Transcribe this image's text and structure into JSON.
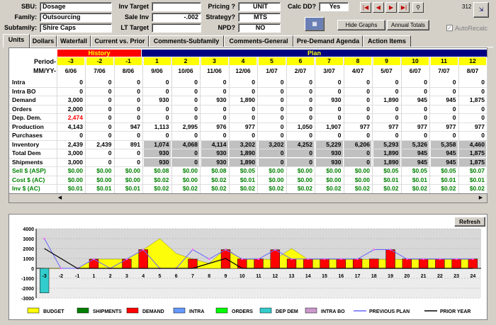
{
  "header": {
    "sbu_label": "SBU:",
    "sbu_value": "Dosage",
    "family_label": "Family:",
    "family_value": "Outsourcing",
    "subfamily_label": "Subfamily:",
    "subfamily_value": "Shire Caps",
    "inv_target_label": "Inv Target",
    "inv_target_value": "",
    "sale_inv_label": "Sale Inv",
    "sale_inv_value": "-.002",
    "lt_target_label": "LT Target",
    "lt_target_value": "",
    "pricing_label": "Pricing ?",
    "pricing_value": "UNIT",
    "strategy_label": "Strategy?",
    "strategy_value": "MTS",
    "npd_label": "NPD?",
    "npd_value": "NO",
    "calc_dd_label": "Calc DD?",
    "calc_dd_value": "Yes",
    "counter": "312",
    "hide_graphs_label": "Hide Graphs",
    "annual_totals_label": "Annual Totals",
    "autorecalc_label": "AutoRecalc"
  },
  "tabs": [
    "Units",
    "Dollars",
    "Waterfall",
    "Current vs. Prior",
    "Comments-Subfamily",
    "Comments-General",
    "Pre-Demand Agenda",
    "Action Items"
  ],
  "grid": {
    "history_label": "History",
    "plan_label": "Plan",
    "period_label": "Period-",
    "mmyy_label": "MM/YY-",
    "periods": [
      "-3",
      "-2",
      "-1",
      "1",
      "2",
      "3",
      "4",
      "5",
      "6",
      "7",
      "8",
      "9",
      "10",
      "11",
      "12"
    ],
    "dates": [
      "6/06",
      "7/06",
      "8/06",
      "9/06",
      "10/06",
      "11/06",
      "12/06",
      "1/07",
      "2/07",
      "3/07",
      "4/07",
      "5/07",
      "6/07",
      "7/07",
      "8/07"
    ],
    "rows": [
      {
        "label": "Intra",
        "values": [
          "0",
          "0",
          "0",
          "0",
          "0",
          "0",
          "0",
          "0",
          "0",
          "0",
          "0",
          "0",
          "0",
          "0",
          "0"
        ]
      },
      {
        "label": "Intra BO",
        "values": [
          "0",
          "0",
          "0",
          "0",
          "0",
          "0",
          "0",
          "0",
          "0",
          "0",
          "0",
          "0",
          "0",
          "0",
          "0"
        ]
      },
      {
        "label": "Demand",
        "values": [
          "3,000",
          "0",
          "0",
          "930",
          "0",
          "930",
          "1,890",
          "0",
          "0",
          "930",
          "0",
          "1,890",
          "945",
          "945",
          "1,875"
        ]
      },
      {
        "label": "Orders",
        "values": [
          "2,000",
          "0",
          "0",
          "0",
          "0",
          "0",
          "0",
          "0",
          "0",
          "0",
          "0",
          "0",
          "0",
          "0",
          "0"
        ]
      },
      {
        "label": "Dep. Dem.",
        "values": [
          "2,474",
          "0",
          "0",
          "0",
          "0",
          "0",
          "0",
          "0",
          "0",
          "0",
          "0",
          "0",
          "0",
          "0",
          "0"
        ]
      },
      {
        "label": "Production",
        "values": [
          "4,143",
          "0",
          "947",
          "1,113",
          "2,995",
          "976",
          "977",
          "0",
          "1,050",
          "1,907",
          "977",
          "977",
          "977",
          "977",
          "977"
        ]
      },
      {
        "label": "Purchases",
        "values": [
          "0",
          "0",
          "0",
          "0",
          "0",
          "0",
          "0",
          "0",
          "0",
          "0",
          "0",
          "0",
          "0",
          "0",
          "0"
        ]
      },
      {
        "label": "Inventory",
        "values": [
          "2,439",
          "2,439",
          "891",
          "1,074",
          "4,068",
          "4,114",
          "3,202",
          "3,202",
          "4,252",
          "5,229",
          "6,206",
          "5,293",
          "5,326",
          "5,358",
          "4,460"
        ]
      },
      {
        "label": "Total Dem",
        "values": [
          "3,000",
          "0",
          "0",
          "930",
          "0",
          "930",
          "1,890",
          "0",
          "0",
          "930",
          "0",
          "1,890",
          "945",
          "945",
          "1,875"
        ]
      },
      {
        "label": "Shipments",
        "values": [
          "3,000",
          "0",
          "0",
          "930",
          "0",
          "930",
          "1,890",
          "0",
          "0",
          "930",
          "0",
          "1,890",
          "945",
          "945",
          "1,875"
        ]
      },
      {
        "label": "Sell $ (ASP)",
        "values": [
          "$0.00",
          "$0.00",
          "$0.00",
          "$0.08",
          "$0.00",
          "$0.08",
          "$0.05",
          "$0.00",
          "$0.00",
          "$0.00",
          "$0.00",
          "$0.05",
          "$0.05",
          "$0.05",
          "$0.07"
        ]
      },
      {
        "label": "Cost $ (AC)",
        "values": [
          "$0.00",
          "$0.00",
          "$0.00",
          "$0.02",
          "$0.00",
          "$0.02",
          "$0.01",
          "$0.00",
          "$0.00",
          "$0.00",
          "$0.00",
          "$0.01",
          "$0.01",
          "$0.01",
          "$0.01"
        ]
      },
      {
        "label": "Inv $ (AC)",
        "values": [
          "$0.01",
          "$0.01",
          "$0.01",
          "$0.02",
          "$0.02",
          "$0.02",
          "$0.02",
          "$0.02",
          "$0.02",
          "$0.02",
          "$0.02",
          "$0.02",
          "$0.02",
          "$0.02",
          "$0.02"
        ]
      }
    ]
  },
  "chart_data": {
    "type": "bar",
    "refresh_label": "Refresh",
    "categories": [
      "-3",
      "-2",
      "-1",
      "1",
      "2",
      "3",
      "4",
      "5",
      "6",
      "7",
      "8",
      "9",
      "10",
      "11",
      "12",
      "13",
      "14",
      "15",
      "16",
      "17",
      "18",
      "19",
      "20",
      "21",
      "22",
      "23",
      "24"
    ],
    "ylim": [
      -3000,
      4000
    ],
    "yticks": [
      "4000",
      "3000",
      "2000",
      "1000",
      "0",
      "-1000",
      "-2000",
      "-3000"
    ],
    "series": [
      {
        "name": "BUDGET",
        "color": "#ffff00",
        "values": [
          0,
          0,
          0,
          930,
          930,
          930,
          1890,
          3000,
          1500,
          930,
          500,
          2000,
          900,
          900,
          900,
          2000,
          900,
          900,
          900,
          900,
          900,
          900,
          900,
          900,
          900,
          900,
          900
        ]
      },
      {
        "name": "SHIPMENTS",
        "color": "#008000",
        "values": [
          3000,
          0,
          0,
          930,
          0,
          930,
          1890,
          0,
          0,
          930,
          0,
          1890,
          945,
          945,
          1875,
          945,
          945,
          945,
          945,
          945,
          945,
          945,
          945,
          945,
          945,
          945,
          945
        ]
      },
      {
        "name": "DEMAND",
        "color": "#ff0000",
        "values": [
          0,
          0,
          0,
          930,
          0,
          930,
          1890,
          0,
          0,
          930,
          0,
          1890,
          945,
          945,
          1875,
          945,
          945,
          945,
          945,
          945,
          945,
          1890,
          945,
          945,
          945,
          945,
          945
        ]
      },
      {
        "name": "INTRA",
        "color": "#6699ff",
        "values": [
          0,
          0,
          0,
          0,
          0,
          0,
          0,
          0,
          0,
          0,
          0,
          0,
          0,
          0,
          0,
          0,
          0,
          0,
          0,
          0,
          0,
          0,
          0,
          0,
          0,
          0,
          0
        ]
      },
      {
        "name": "ORDERS",
        "color": "#00ff00",
        "values": [
          2000,
          0,
          0,
          0,
          0,
          0,
          0,
          0,
          0,
          0,
          0,
          0,
          0,
          0,
          0,
          0,
          0,
          0,
          0,
          0,
          0,
          0,
          0,
          0,
          0,
          0,
          0
        ]
      },
      {
        "name": "DEP DEM",
        "color": "#33cccc",
        "values": [
          -2474,
          0,
          0,
          0,
          0,
          0,
          0,
          0,
          0,
          0,
          0,
          0,
          0,
          0,
          0,
          0,
          0,
          0,
          0,
          0,
          0,
          0,
          0,
          0,
          0,
          0,
          0
        ]
      },
      {
        "name": "INTRA BO",
        "color": "#cc99cc",
        "values": [
          0,
          0,
          0,
          0,
          0,
          0,
          0,
          0,
          0,
          0,
          0,
          0,
          0,
          0,
          0,
          0,
          0,
          0,
          0,
          0,
          0,
          0,
          0,
          0,
          0,
          0,
          0
        ]
      },
      {
        "name": "PREVIOUS PLAN",
        "color": "#6666ff",
        "values": [
          3000,
          0,
          0,
          930,
          0,
          930,
          1890,
          0,
          0,
          1890,
          945,
          1890,
          945,
          945,
          1875,
          945,
          945,
          945,
          945,
          945,
          1890,
          1890,
          945,
          945,
          945,
          945,
          945
        ]
      },
      {
        "name": "PRIOR YEAR",
        "color": "#000000",
        "values": [
          2000,
          1000,
          0,
          0,
          0,
          0,
          0,
          0,
          0,
          0,
          500,
          1000,
          0,
          0,
          0,
          0,
          0,
          0,
          0,
          0,
          0,
          0,
          0,
          0,
          0,
          0,
          0
        ]
      }
    ]
  }
}
